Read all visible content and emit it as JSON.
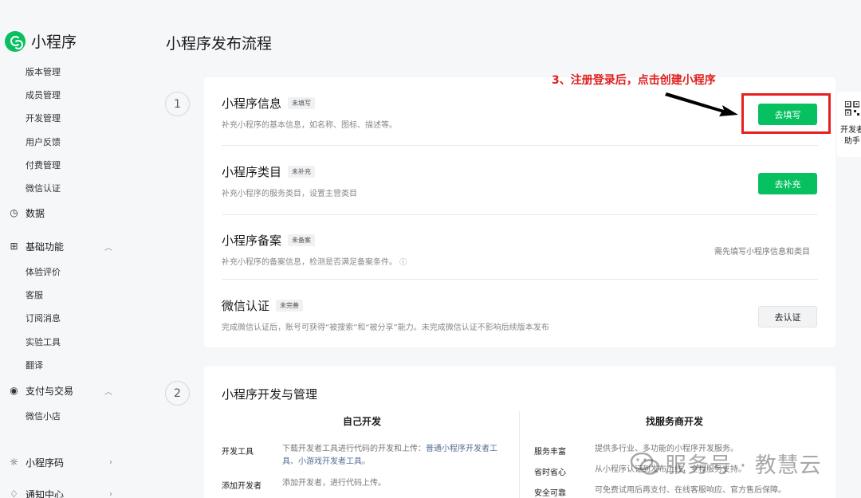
{
  "brand": {
    "name": "小程序"
  },
  "sidebar": {
    "sub_items_top": [
      "版本管理",
      "成员管理",
      "开发管理",
      "用户反馈",
      "付费管理",
      "微信认证"
    ],
    "group_data": "数据",
    "group_basic": "基础功能",
    "basic_items": [
      "体验评价",
      "客服",
      "订阅消息",
      "实验工具",
      "翻译"
    ],
    "group_pay": "支付与交易",
    "pay_items": [
      "微信小店"
    ],
    "group_code": "小程序码",
    "group_notice": "通知中心"
  },
  "page": {
    "title": "小程序发布流程"
  },
  "steps": [
    "1",
    "2"
  ],
  "card1": {
    "rows": [
      {
        "title": "小程序信息",
        "tag": "未填写",
        "desc": "补充小程序的基本信息，如名称、图标、描述等。",
        "action": "去填写"
      },
      {
        "title": "小程序类目",
        "tag": "未补充",
        "desc": "补充小程序的服务类目，设置主营类目",
        "action": "去补充"
      },
      {
        "title": "小程序备案",
        "tag": "未备案",
        "desc": "补充小程序的备案信息，检测是否满足备案条件。",
        "hint": "需先填写小程序信息和类目"
      },
      {
        "title": "微信认证",
        "tag": "未完善",
        "desc": "完成微信认证后，账号可获得“被搜索”和“被分享”能力。未完成微信认证不影响后续版本发布",
        "action": "去认证"
      }
    ]
  },
  "annotation": {
    "text": "3、注册登录后，点击创建小程序"
  },
  "helper": {
    "line1": "开发者",
    "line2": "助手"
  },
  "card2": {
    "title": "小程序开发与管理",
    "left_col": {
      "title": "自己开发",
      "rows": [
        {
          "label": "开发工具",
          "text": "下载开发者工具进行代码的开发和上传：",
          "link1": "普通小程序开发者工具",
          "sep": "、",
          "link2": "小游戏开发者工具",
          "end": "。"
        },
        {
          "label": "添加开发者",
          "text": "添加开发者，进行代码上传。"
        }
      ]
    },
    "right_col": {
      "title": "找服务商开发",
      "rows": [
        {
          "label": "服务丰富",
          "text": "提供多行业、多功能的小程序开发服务。"
        },
        {
          "label": "省时省心",
          "text": "从小程序认证到发布上线，全程服务支持。"
        },
        {
          "label": "安全可靠",
          "text": "可免费试用后再支付、在线客服响应、官方售后保障。"
        }
      ]
    }
  },
  "watermark": {
    "text": "服务号 · 教慧云"
  },
  "colors": {
    "accent": "#07c160",
    "annotation": "#e62020",
    "link": "#576b95"
  }
}
